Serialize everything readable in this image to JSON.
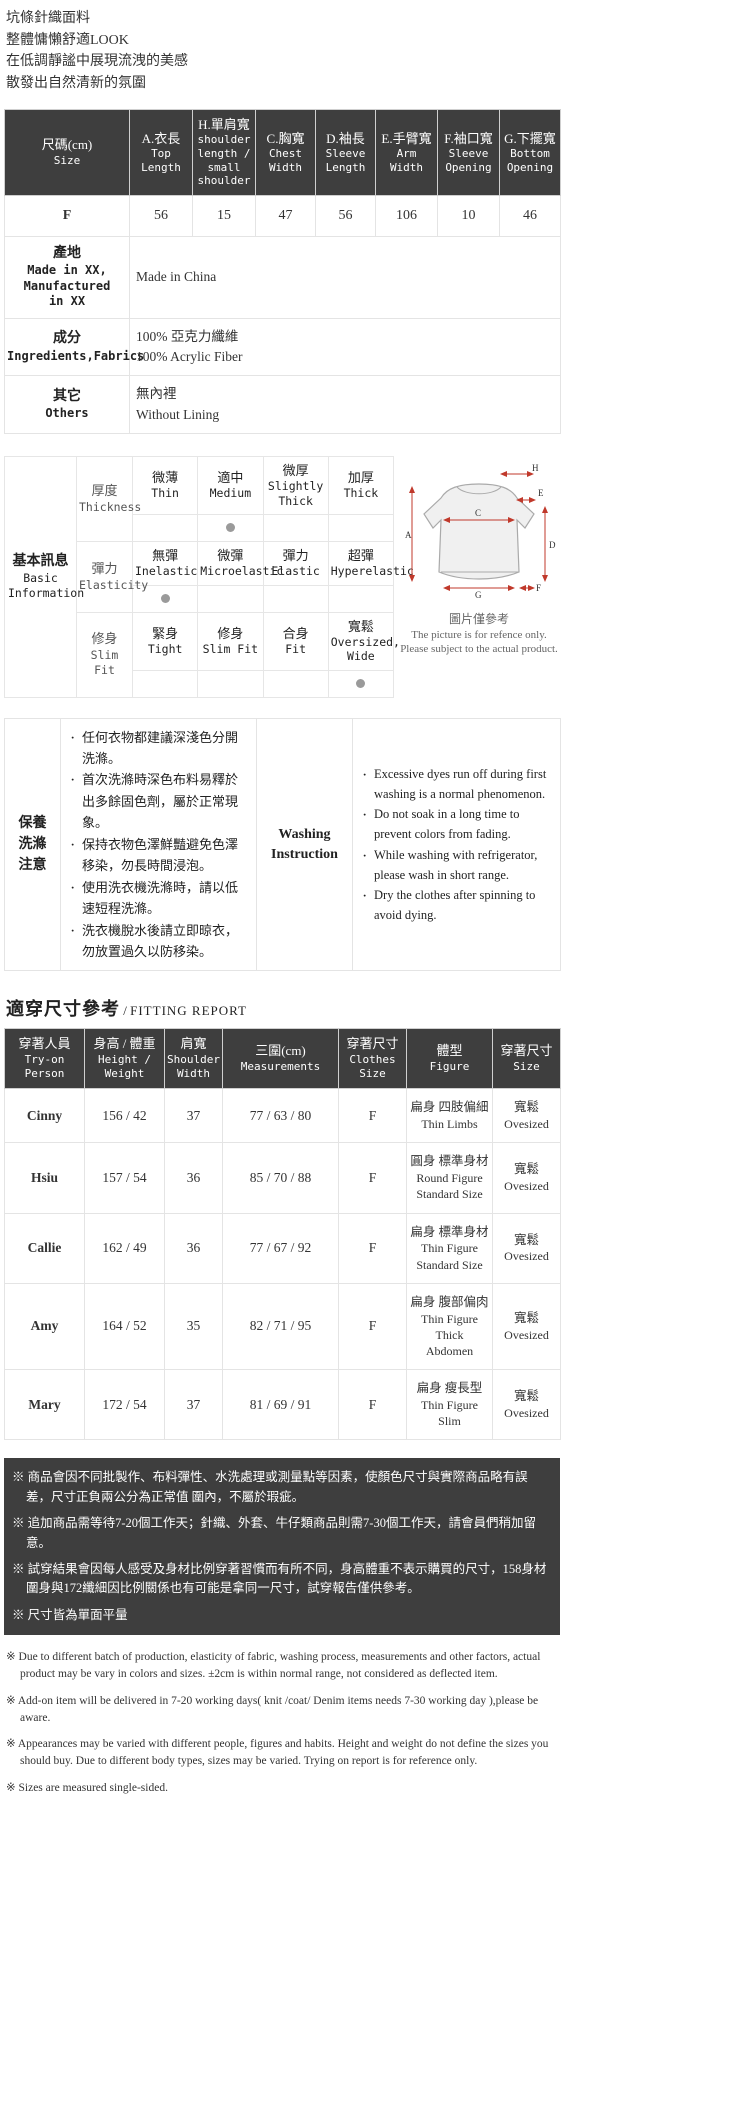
{
  "intro": [
    "坑條針織面料",
    "整體慵懶舒適LOOK",
    "在低調靜謐中展現流洩的美感",
    "散發出自然清新的氛圍"
  ],
  "size_table": {
    "headers": [
      {
        "cn": "尺碼(cm)",
        "en": "Size"
      },
      {
        "cn": "A.衣長",
        "en": "Top\nLength"
      },
      {
        "cn": "H.單肩寬",
        "en": "shoulder\nlength /\nsmall\nshoulder"
      },
      {
        "cn": "C.胸寬",
        "en": "Chest\nWidth"
      },
      {
        "cn": "D.袖長",
        "en": "Sleeve\nLength"
      },
      {
        "cn": "E.手臂寬",
        "en": "Arm\nWidth"
      },
      {
        "cn": "F.袖口寬",
        "en": "Sleeve\nOpening"
      },
      {
        "cn": "G.下擺寬",
        "en": "Bottom\nOpening"
      }
    ],
    "rows": [
      {
        "size": "F",
        "values": [
          "56",
          "15",
          "47",
          "56",
          "106",
          "10",
          "46"
        ]
      }
    ],
    "info_rows": [
      {
        "label_cn": "產地",
        "label_en": "Made in XX,\nManufactured\nin XX",
        "value_cn": "Made in China",
        "value_en": ""
      },
      {
        "label_cn": "成分",
        "label_en": "Ingredients,Fabrics",
        "value_cn": "100% 亞克力纖維",
        "value_en": "100% Acrylic Fiber"
      },
      {
        "label_cn": "其它",
        "label_en": "Others",
        "value_cn": "無內裡",
        "value_en": "Without Lining"
      }
    ]
  },
  "basic_info": {
    "title_cn": "基本訊息",
    "title_en1": "Basic",
    "title_en2": "Information",
    "rows": [
      {
        "attr_cn": "厚度",
        "attr_en": "Thickness",
        "options": [
          {
            "cn": "微薄",
            "en": "Thin",
            "selected": false
          },
          {
            "cn": "適中",
            "en": "Medium",
            "selected": true
          },
          {
            "cn": "微厚",
            "en": "Slightly Thick",
            "selected": false
          },
          {
            "cn": "加厚",
            "en": "Thick",
            "selected": false
          }
        ]
      },
      {
        "attr_cn": "彈力",
        "attr_en": "Elasticity",
        "options": [
          {
            "cn": "無彈",
            "en": "Inelastic",
            "selected": true
          },
          {
            "cn": "微彈",
            "en": "Microelastic",
            "selected": false
          },
          {
            "cn": "彈力",
            "en": "Elastic",
            "selected": false
          },
          {
            "cn": "超彈",
            "en": "Hyperelastic",
            "selected": false
          }
        ]
      },
      {
        "attr_cn": "修身",
        "attr_en": "Slim Fit",
        "options": [
          {
            "cn": "緊身",
            "en": "Tight",
            "selected": false
          },
          {
            "cn": "修身",
            "en": "Slim Fit",
            "selected": false
          },
          {
            "cn": "合身",
            "en": "Fit",
            "selected": false
          },
          {
            "cn": "寬鬆",
            "en": "Oversized, Wide",
            "selected": true
          }
        ]
      }
    ],
    "diagram": {
      "markers": [
        "A",
        "C",
        "D",
        "E",
        "F",
        "G",
        "H"
      ],
      "caption_cn": "圖片僅參考",
      "caption_en": "The picture is for refence only. Please subject to the actual product."
    }
  },
  "washing": {
    "label_cn": "保養\n洗滌\n注意",
    "label_en": "Washing\nInstruction",
    "items_cn": [
      "任何衣物都建議深淺色分開洗滌。",
      "首次洗滌時深色布料易釋於出多餘固色劑，屬於正常現象。",
      "保持衣物色澤鮮豔避免色澤移染，勿長時間浸泡。",
      "使用洗衣機洗滌時，請以低速短程洗滌。",
      "洗衣機脫水後請立即晾衣，勿放置過久以防移染。"
    ],
    "items_en": [
      "Excessive dyes run off during first washing is a normal phenomenon.",
      "Do not soak in a long time to prevent colors from fading.",
      "While washing with refrigerator, please wash in short range.",
      "Dry the clothes after spinning to avoid dying."
    ]
  },
  "fitting_report": {
    "title_cn": "適穿尺寸參考",
    "title_sep": " / ",
    "title_en": "FITTING REPORT",
    "headers": [
      {
        "cn": "穿著人員",
        "en": "Try-on\nPerson"
      },
      {
        "cn": "身高 / 體重",
        "en": "Height /\nWeight"
      },
      {
        "cn": "肩寬",
        "en": "Shoulder\nWidth"
      },
      {
        "cn": "三圍(cm)",
        "en": "Measurements"
      },
      {
        "cn": "穿著尺寸",
        "en": "Clothes\nSize"
      },
      {
        "cn": "體型",
        "en": "Figure"
      },
      {
        "cn": "穿著尺寸",
        "en": "Size"
      }
    ],
    "rows": [
      {
        "person": "Cinny",
        "height_weight": "156 / 42",
        "shoulder": "37",
        "measurements": "77 / 63 / 80",
        "clothes_size": "F",
        "figure_cn": "扁身 四肢偏細",
        "figure_en": "Thin Limbs",
        "size_cn": "寬鬆",
        "size_en": "Ovesized"
      },
      {
        "person": "Hsiu",
        "height_weight": "157 / 54",
        "shoulder": "36",
        "measurements": "85 / 70 / 88",
        "clothes_size": "F",
        "figure_cn": "圓身 標準身材",
        "figure_en": "Round Figure\nStandard Size",
        "size_cn": "寬鬆",
        "size_en": "Ovesized"
      },
      {
        "person": "Callie",
        "height_weight": "162 / 49",
        "shoulder": "36",
        "measurements": "77 / 67 / 92",
        "clothes_size": "F",
        "figure_cn": "扁身 標準身材",
        "figure_en": "Thin Figure\nStandard Size",
        "size_cn": "寬鬆",
        "size_en": "Ovesized"
      },
      {
        "person": "Amy",
        "height_weight": "164 / 52",
        "shoulder": "35",
        "measurements": "82 / 71 / 95",
        "clothes_size": "F",
        "figure_cn": "扁身 腹部偏肉",
        "figure_en": "Thin Figure\nThick\nAbdomen",
        "size_cn": "寬鬆",
        "size_en": "Ovesized"
      },
      {
        "person": "Mary",
        "height_weight": "172 / 54",
        "shoulder": "37",
        "measurements": "81 / 69 / 91",
        "clothes_size": "F",
        "figure_cn": "扁身 瘦長型",
        "figure_en": "Thin Figure\nSlim",
        "size_cn": "寬鬆",
        "size_en": "Ovesized"
      }
    ]
  },
  "notes_cn": [
    "※ 商品會因不同批製作、布料彈性、水洗處理或測量點等因素，使顏色尺寸與實際商品略有誤差，尺寸正負兩公分為正常值 圍內，不屬於瑕疵。",
    "※ 追加商品需等待7-20個工作天；針織、外套、牛仔類商品則需7-30個工作天，請會員們稍加留意。",
    "※ 試穿結果會因每人感受及身材比例穿著習慣而有所不同，身高體重不表示購買的尺寸，158身材圍身與172纖細因比例關係也有可能是拿同一尺寸，試穿報告僅供參考。",
    "※ 尺寸皆為單面平量"
  ],
  "notes_en": [
    "※ Due to different batch of production, elasticity of fabric, washing process, measurements and other factors, actual product may be vary in colors and sizes. ±2cm is within normal range, not considered as deflected item.",
    "※ Add-on item will be delivered in 7-20 working days( knit /coat/ Denim items needs 7-30 working day ),please be aware.",
    "※ Appearances may be varied with different people, figures and habits. Height and weight do not define the sizes you should buy. Due to different body types, sizes may be varied. Trying on report is for reference only.",
    "※ Sizes are measured single-sided."
  ],
  "colors": {
    "header_bg": "#3e3e3e",
    "header_text": "#ffffff",
    "border": "#e4e4e4",
    "dot": "#9a9a9a",
    "diagram_accent": "#c0392b"
  }
}
